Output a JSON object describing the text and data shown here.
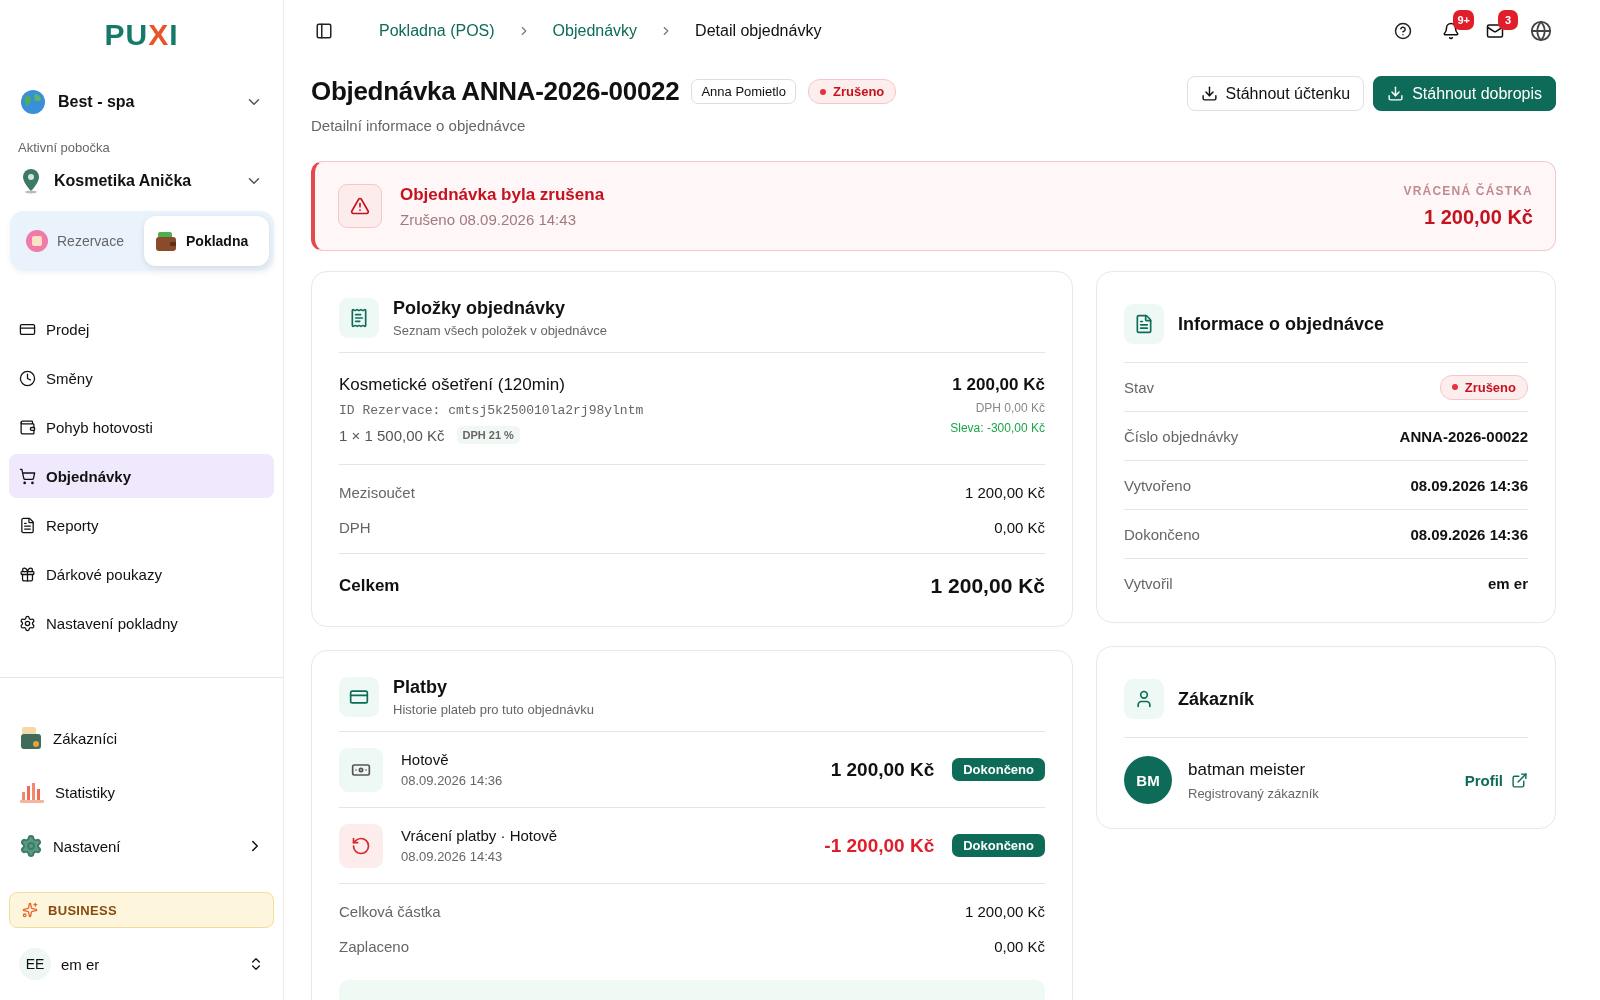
{
  "logo": {
    "parts": [
      {
        "text": "PU",
        "accent": false
      },
      {
        "text": "X",
        "accent": true
      },
      {
        "text": "I",
        "accent": false
      }
    ]
  },
  "workspace": {
    "name": "Best - spa"
  },
  "branch": {
    "label": "Aktivní pobočka",
    "name": "Kosmetika Anička"
  },
  "mode_switch": [
    {
      "label": "Rezervace",
      "kind": "calendar",
      "selected": false
    },
    {
      "label": "Pokladna",
      "kind": "wallet",
      "selected": true
    }
  ],
  "nav": [
    {
      "label": "Prodej",
      "selected": false
    },
    {
      "label": "Směny",
      "selected": false
    },
    {
      "label": "Pohyb hotovosti",
      "selected": false
    },
    {
      "label": "Objednávky",
      "selected": true
    },
    {
      "label": "Reporty",
      "selected": false
    },
    {
      "label": "Dárkové poukazy",
      "selected": false
    },
    {
      "label": "Nastavení pokladny",
      "selected": false
    }
  ],
  "bottom_nav": [
    {
      "label": "Zákazníci",
      "has_submenu": false
    },
    {
      "label": "Statistiky",
      "has_submenu": false
    },
    {
      "label": "Nastavení",
      "has_submenu": true
    }
  ],
  "plan": {
    "label": "BUSINESS"
  },
  "user": {
    "initials": "EE",
    "name": "em er"
  },
  "breadcrumbs": [
    {
      "label": "Pokladna (POS)",
      "current": false
    },
    {
      "label": "Objednávky",
      "current": false
    },
    {
      "label": "Detail objednávky",
      "current": true
    }
  ],
  "notifications": {
    "badge": "9+"
  },
  "messages": {
    "badge": "3"
  },
  "page": {
    "title": "Objednávka ANNA-2026-00022",
    "cashier": "Anna Pomietlo",
    "status": {
      "label": "Zrušeno",
      "kind": "danger"
    },
    "subtitle": "Detailní informace o objednávce"
  },
  "actions": [
    {
      "label": "Stáhnout účtenku",
      "primary": false
    },
    {
      "label": "Stáhnout dobropis",
      "primary": true
    }
  ],
  "alert": {
    "title": "Objednávka byla zrušena",
    "subtitle": "Zrušeno 08.09.2026 14:43",
    "amount_label": "VRÁCENÁ ČÁSTKA",
    "amount": "1 200,00 Kč"
  },
  "items_card": {
    "title": "Položky objednávky",
    "subtitle": "Seznam všech položek v objednávce",
    "items": [
      {
        "name": "Kosmetické ošetření (120min)",
        "reference": "ID Rezervace: cmtsj5k250010la2rj98ylntm",
        "quantity": "1 × 1 500,00 Kč",
        "vat_tag": "DPH 21 %",
        "total": "1 200,00 Kč",
        "vat": "DPH 0,00 Kč",
        "discount": "Sleva: -300,00 Kč"
      }
    ],
    "summary": [
      {
        "label": "Mezisoučet",
        "value": "1 200,00 Kč"
      },
      {
        "label": "DPH",
        "value": "0,00 Kč"
      }
    ],
    "total": {
      "label": "Celkem",
      "value": "1 200,00 Kč"
    }
  },
  "payments_card": {
    "title": "Platby",
    "subtitle": "Historie plateb pro tuto objednávku",
    "payments": [
      {
        "kind": "payment",
        "method": "Hotově",
        "date": "08.09.2026 14:36",
        "amount": "1 200,00 Kč",
        "status": {
          "label": "Dokončeno",
          "kind": "success"
        }
      },
      {
        "kind": "refund",
        "method": "Vrácení platby · Hotově",
        "date": "08.09.2026 14:43",
        "amount": "-1 200,00 Kč",
        "status": {
          "label": "Dokončeno",
          "kind": "success"
        }
      }
    ],
    "summary": [
      {
        "label": "Celková částka",
        "value": "1 200,00 Kč"
      },
      {
        "label": "Zaplaceno",
        "value": "0,00 Kč"
      }
    ]
  },
  "info_card": {
    "title": "Informace o objednávce",
    "rows": [
      {
        "label": "Stav",
        "kind": "status",
        "status": {
          "label": "Zrušeno",
          "kind": "danger"
        }
      },
      {
        "label": "Číslo objednávky",
        "kind": "text",
        "value": "ANNA-2026-00022"
      },
      {
        "label": "Vytvořeno",
        "kind": "text",
        "value": "08.09.2026 14:36"
      },
      {
        "label": "Dokončeno",
        "kind": "text",
        "value": "08.09.2026 14:36"
      },
      {
        "label": "Vytvořil",
        "kind": "text",
        "value": "em er"
      }
    ]
  },
  "customer_card": {
    "title": "Zákazník",
    "initials": "BM",
    "name": "batman meister",
    "type": "Registrovaný zákazník",
    "link": "Profil"
  }
}
